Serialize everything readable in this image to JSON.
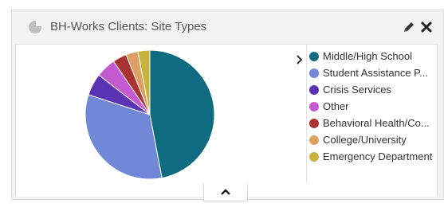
{
  "widget": {
    "title": "BH-Works Clients: Site Types",
    "title_icon": "pie-chart-icon",
    "edit_icon": "pencil-icon",
    "close_icon": "close-icon",
    "legend_toggle_icon": "chevron-right-icon",
    "collapse_icon": "chevron-up-icon"
  },
  "chart_data": {
    "type": "pie",
    "title": "BH-Works Clients: Site Types",
    "legend_position": "right",
    "legend_labels": [
      "Middle/High School",
      "Student Assistance P...",
      "Crisis Services",
      "Other",
      "Behavioral Health/Co...",
      "College/University",
      "Emergency Department"
    ],
    "series": [
      {
        "values": [
          47,
          33,
          5.5,
          5,
          3.5,
          3,
          3
        ]
      }
    ],
    "colors": [
      "#0f6b80",
      "#7088d6",
      "#5a33b4",
      "#c45ad0",
      "#aa3232",
      "#dca064",
      "#c8b43c"
    ]
  }
}
